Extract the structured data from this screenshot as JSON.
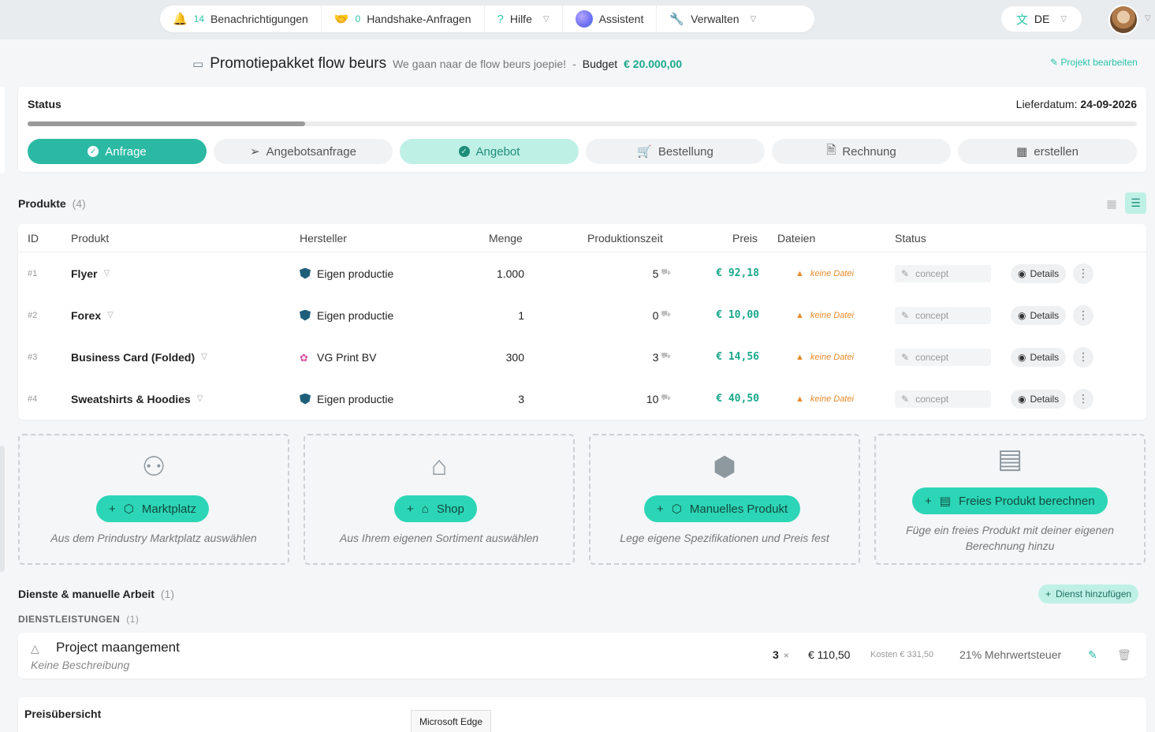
{
  "topnav": {
    "notifications": {
      "count": "14",
      "label": "Benachrichtigungen"
    },
    "handshake": {
      "count": "0",
      "label": "Handshake-Anfragen"
    },
    "help": {
      "label": "Hilfe"
    },
    "assistant": {
      "label": "Assistent"
    },
    "manage": {
      "label": "Verwalten"
    },
    "language": "DE"
  },
  "project": {
    "title": "Promotiepakket flow beurs",
    "subtitle": "We gaan naar de flow beurs joepie!",
    "separator": "-",
    "budget_label": "Budget",
    "budget_value": "€ 20.000,00",
    "edit_label": "Projekt bearbeiten"
  },
  "status": {
    "label": "Status",
    "delivery_label": "Lieferdatum:",
    "delivery_date": "24-09-2026",
    "progress": 0.25,
    "steps": [
      {
        "label": "Anfrage",
        "state": "done"
      },
      {
        "label": "Angebotsanfrage",
        "state": "pending"
      },
      {
        "label": "Angebot",
        "state": "active"
      },
      {
        "label": "Bestellung",
        "state": "pending"
      },
      {
        "label": "Rechnung",
        "state": "pending"
      },
      {
        "label": "erstellen",
        "state": "pending"
      }
    ]
  },
  "products": {
    "title": "Produkte",
    "count": "(4)",
    "columns": [
      "ID",
      "Produkt",
      "Hersteller",
      "Menge",
      "Produktionszeit",
      "Preis",
      "Dateien",
      "Status"
    ],
    "rows": [
      {
        "id": "#1",
        "name": "Flyer",
        "maker": "Eigen productie",
        "qty": "1.000",
        "time": "5",
        "price": "€ 92,18",
        "files": "keine Datei",
        "status": "concept",
        "details": "Details"
      },
      {
        "id": "#2",
        "name": "Forex",
        "maker": "Eigen productie",
        "qty": "1",
        "time": "0",
        "price": "€ 10,00",
        "files": "keine Datei",
        "status": "concept",
        "details": "Details"
      },
      {
        "id": "#3",
        "name": "Business Card (Folded)",
        "maker": "VG Print BV",
        "qty": "300",
        "time": "3",
        "price": "€ 14,56",
        "files": "keine Datei",
        "status": "concept",
        "details": "Details"
      },
      {
        "id": "#4",
        "name": "Sweatshirts & Hoodies",
        "maker": "Eigen productie",
        "qty": "3",
        "time": "10",
        "price": "€ 40,50",
        "files": "keine Datei",
        "status": "concept",
        "details": "Details"
      }
    ]
  },
  "add_options": [
    {
      "button": "Marktplatz",
      "desc": "Aus dem Prindustry Marktplatz auswählen"
    },
    {
      "button": "Shop",
      "desc": "Aus Ihrem eigenen Sortiment auswählen"
    },
    {
      "button": "Manuelles Produkt",
      "desc": "Lege eigene Spezifikationen und Preis fest"
    },
    {
      "button": "Freies Produkt berechnen",
      "desc": "Füge ein freies Produkt mit deiner eigenen Berechnung hinzu"
    }
  ],
  "services": {
    "title": "Dienste & manuelle Arbeit",
    "count": "(1)",
    "add_label": "Dienst hinzufügen",
    "sub_title": "DIENSTLEISTUNGEN",
    "sub_count": "(1)",
    "item": {
      "name": "Project maangement",
      "desc": "Keine Beschreibung",
      "qty": "3",
      "qty_unit": "×",
      "price": "€ 110,50",
      "cost": "Kosten € 331,50",
      "vat": "21% Mehrwertsteuer"
    }
  },
  "price_overview": {
    "title": "Preisübersicht"
  },
  "tooltip": "Microsoft Edge"
}
